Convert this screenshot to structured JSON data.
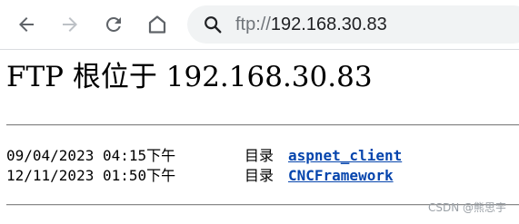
{
  "browser": {
    "url_scheme": "ftp://",
    "url_host": "192.168.30.83",
    "icons": {
      "back": "arrow-left-icon",
      "forward": "arrow-right-icon",
      "reload": "reload-icon",
      "home": "home-icon",
      "search": "search-icon"
    },
    "forward_enabled": false
  },
  "page": {
    "title": "FTP 根位于 192.168.30.83",
    "entries": [
      {
        "datetime": "09/04/2023 04:15下午",
        "kind": "目录",
        "name": "aspnet_client"
      },
      {
        "datetime": "12/11/2023 01:50下午",
        "kind": "目录",
        "name": "CNCFramework"
      }
    ]
  },
  "watermark": "CSDN @熊思宇",
  "colors": {
    "link": "#0645ad",
    "omnibox_bg": "#f1f3f4",
    "icon": "#5f6368",
    "icon_disabled": "#bdc1c6"
  }
}
